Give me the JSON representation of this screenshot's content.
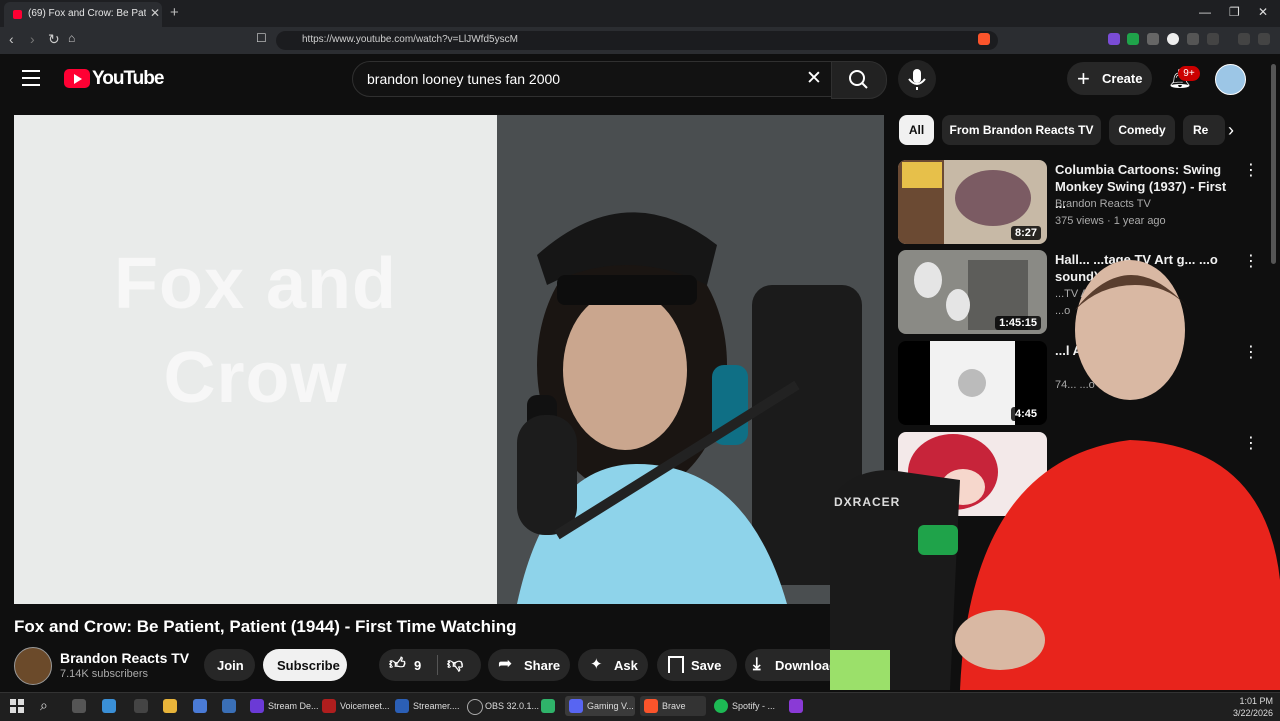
{
  "browser": {
    "tab_title": "(69) Fox and Crow: Be Patient, Pa",
    "url": "https://www.youtube.com/watch?v=LlJWfd5yscM"
  },
  "header": {
    "logo_text": "YouTube",
    "search_query": "brandon looney tunes fan 2000",
    "create_label": "Create",
    "notifications_badge": "9+"
  },
  "player": {
    "cartoon_line1": "Fox and",
    "cartoon_line2": "Crow",
    "mic_brand": "DXRACER"
  },
  "video": {
    "title": "Fox and Crow: Be Patient, Patient (1944) - First Time Watching",
    "channel": "Brandon Reacts TV",
    "subscribers": "7.14K subscribers",
    "join_label": "Join",
    "subscribe_label": "Subscribe",
    "like_count": "9",
    "share_label": "Share",
    "ask_label": "Ask",
    "save_label": "Save",
    "download_label": "Download"
  },
  "chips": [
    "All",
    "From Brandon Reacts TV",
    "Comedy",
    "Re"
  ],
  "recommendations": [
    {
      "title": "Columbia Cartoons: Swing Monkey Swing (1937) - First ...",
      "channel": "Brandon Reacts TV",
      "meta": "375 views · 1 year ago",
      "duration": "8:27"
    },
    {
      "title": "Hall... ...tage TV Art g... ...o sound) ...",
      "channel": "...TV Art",
      "meta": "...o",
      "duration": "1:45:15"
    },
    {
      "title": "...l Alaska",
      "channel": "",
      "meta": "74... ...o",
      "duration": "4:45"
    },
    {
      "title": "",
      "channel": "",
      "meta": "",
      "duration": ""
    }
  ],
  "taskbar": {
    "apps": [
      "Stream De...",
      "Voicemeet...",
      "Streamer....",
      "OBS 32.0.1...",
      "Gaming V...",
      "Brave",
      "Spotify - ..."
    ],
    "time": "1:01 PM",
    "date": "3/22/2026"
  },
  "colors": {
    "brand_red": "#ff0033",
    "background": "#0f0f0f",
    "chip_bg": "#272727"
  }
}
